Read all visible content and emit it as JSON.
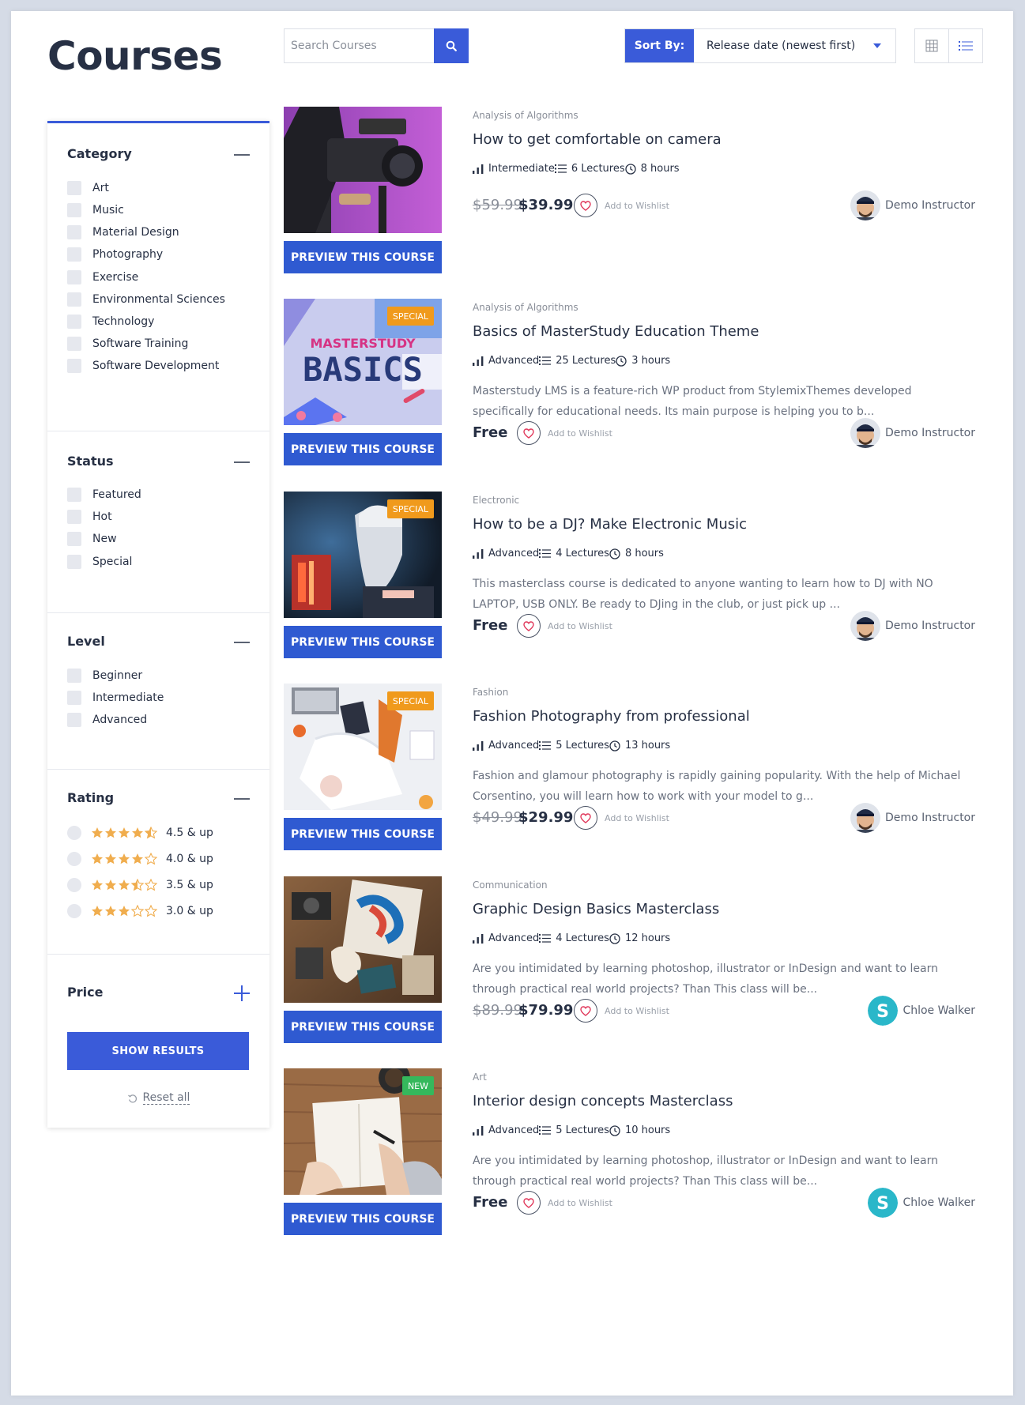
{
  "header": {
    "title": "Courses",
    "search_placeholder": "Search Courses",
    "sort_label": "Sort By:",
    "sort_value": "Release date (newest first)"
  },
  "filters": {
    "category": {
      "title": "Category",
      "options": [
        "Art",
        "Music",
        "Material Design",
        "Photography",
        "Exercise",
        "Environmental Sciences",
        "Technology",
        "Software Training",
        "Software Development"
      ]
    },
    "status": {
      "title": "Status",
      "options": [
        "Featured",
        "Hot",
        "New",
        "Special"
      ]
    },
    "level": {
      "title": "Level",
      "options": [
        "Beginner",
        "Intermediate",
        "Advanced"
      ]
    },
    "rating": {
      "title": "Rating",
      "options": [
        {
          "label": "4.5 & up",
          "stars": 4.5
        },
        {
          "label": "4.0 & up",
          "stars": 4.0
        },
        {
          "label": "3.5 & up",
          "stars": 3.5
        },
        {
          "label": "3.0 & up",
          "stars": 3.0
        }
      ]
    },
    "price": {
      "title": "Price"
    },
    "show_results": "SHOW RESULTS",
    "reset": "Reset all"
  },
  "colors": {
    "accent": "#3a5bd9",
    "star": "#f0ad4e",
    "special_badge": "#f09a1c",
    "new_badge": "#35b85c"
  },
  "courses": [
    {
      "category": "Analysis of Algorithms",
      "title": "How to get comfortable on camera",
      "level": "Intermediate",
      "lectures": "6 Lectures",
      "duration": "8 hours",
      "description": "",
      "old_price": "$59.99",
      "price": "$39.99",
      "wishlist": "Add to Wishlist",
      "instructor": "Demo Instructor",
      "badge": "",
      "preview": "PREVIEW THIS COURSE"
    },
    {
      "category": "Analysis of Algorithms",
      "title": "Basics of MasterStudy Education Theme",
      "level": "Advanced",
      "lectures": "25 Lectures",
      "duration": "3 hours",
      "description": "Masterstudy LMS is a feature-rich WP product from StylemixThemes developed specifically for educational needs. Its main purpose is helping you to b...",
      "old_price": "",
      "price": "Free",
      "wishlist": "Add to Wishlist",
      "instructor": "Demo Instructor",
      "badge": "SPECIAL",
      "thumb_text_1": "MASTERSTUDY",
      "thumb_text_2": "BASICS",
      "preview": "PREVIEW THIS COURSE"
    },
    {
      "category": "Electronic",
      "title": "How to be a DJ? Make Electronic Music",
      "level": "Advanced",
      "lectures": "4 Lectures",
      "duration": "8 hours",
      "description": "This masterclass course is dedicated to anyone wanting to learn how to DJ with NO LAPTOP, USB ONLY. Be ready to DJing in the club, or just pick up ...",
      "old_price": "",
      "price": "Free",
      "wishlist": "Add to Wishlist",
      "instructor": "Demo Instructor",
      "badge": "SPECIAL",
      "preview": "PREVIEW THIS COURSE"
    },
    {
      "category": "Fashion",
      "title": "Fashion Photography from professional",
      "level": "Advanced",
      "lectures": "5 Lectures",
      "duration": "13 hours",
      "description": "Fashion and glamour photography is rapidly gaining popularity. With the help of Michael Corsentino, you will learn how to work with your model to g...",
      "old_price": "$49.99",
      "price": "$29.99",
      "wishlist": "Add to Wishlist",
      "instructor": "Demo Instructor",
      "badge": "SPECIAL",
      "preview": "PREVIEW THIS COURSE"
    },
    {
      "category": "Communication",
      "title": "Graphic Design Basics Masterclass",
      "level": "Advanced",
      "lectures": "4 Lectures",
      "duration": "12 hours",
      "description": "Are you intimidated by learning photoshop, illustrator or InDesign and want to learn through practical real world projects? Than This class will be...",
      "old_price": "$89.99",
      "price": "$79.99",
      "wishlist": "Add to Wishlist",
      "instructor": "Chloe Walker",
      "badge": "",
      "preview": "PREVIEW THIS COURSE"
    },
    {
      "category": "Art",
      "title": "Interior design concepts Masterclass",
      "level": "Advanced",
      "lectures": "5 Lectures",
      "duration": "10 hours",
      "description": "Are you intimidated by learning photoshop, illustrator or InDesign and want to learn through practical real world projects? Than This class will be...",
      "old_price": "",
      "price": "Free",
      "wishlist": "Add to Wishlist",
      "instructor": "Chloe Walker",
      "badge": "NEW",
      "preview": "PREVIEW THIS COURSE"
    }
  ]
}
